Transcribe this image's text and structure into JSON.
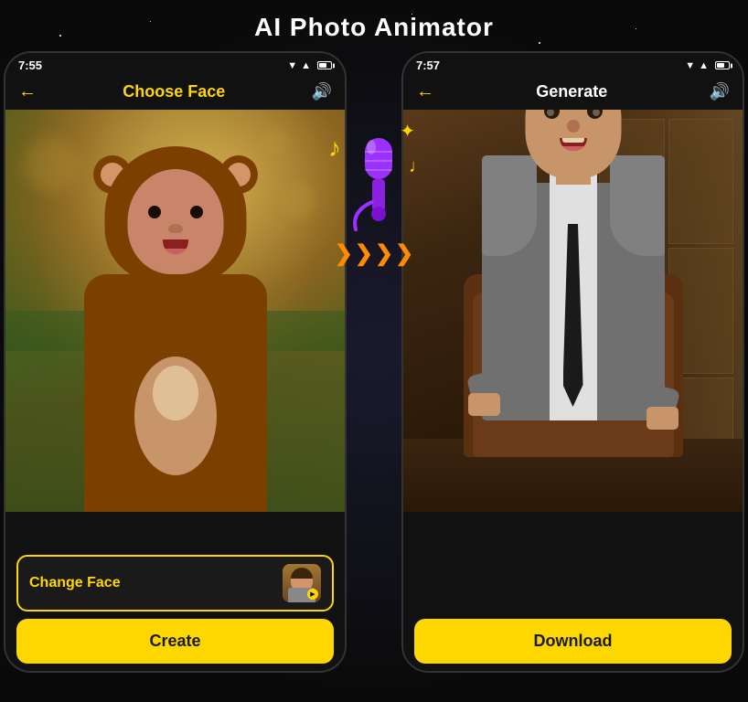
{
  "page": {
    "title": "AI Photo Animator",
    "background_color": "#0a0a0a"
  },
  "phone_left": {
    "status": {
      "time": "7:55",
      "signal": true,
      "wifi": true,
      "battery": true
    },
    "nav": {
      "back_icon": "←",
      "title": "Choose Face",
      "sound_icon": "🔊"
    },
    "image_alt": "Child in monkey costume",
    "change_face_label": "Change Face",
    "create_label": "Create"
  },
  "phone_right": {
    "status": {
      "time": "7:57",
      "signal": true,
      "wifi": true,
      "battery": true
    },
    "nav": {
      "back_icon": "←",
      "title": "Generate",
      "sound_icon": "🔊"
    },
    "image_alt": "Man in suit",
    "download_label": "Download"
  },
  "center_overlay": {
    "sparkle": "✦",
    "music_note_1": "♪",
    "music_note_2": "♩",
    "mic_label": "microphone",
    "arrows": [
      "❯",
      "❯",
      "❯",
      "❯"
    ]
  }
}
